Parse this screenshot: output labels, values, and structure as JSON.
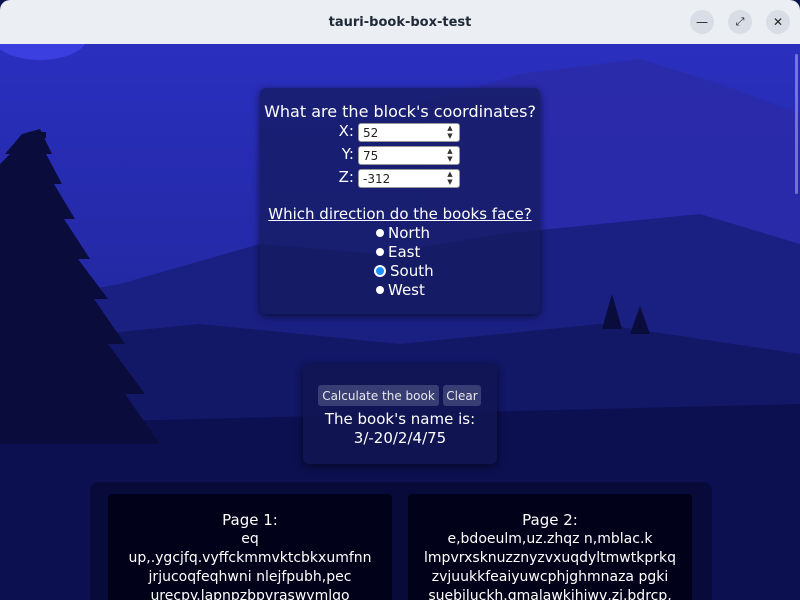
{
  "window": {
    "title": "tauri-book-box-test"
  },
  "coords": {
    "question": "What are the block's coordinates?",
    "x_label": "X:",
    "x_value": "52",
    "y_label": "Y:",
    "y_value": "75",
    "z_label": "Z:",
    "z_value": "-312"
  },
  "direction": {
    "question": "Which direction do the books face?",
    "options": [
      "North",
      "East",
      "South",
      "West"
    ],
    "selected": "South"
  },
  "actions": {
    "calculate_label": "Calculate the book",
    "clear_label": "Clear"
  },
  "result": {
    "label": "The book's name is:",
    "value": "3/-20/2/4/75"
  },
  "pages": [
    {
      "heading": "Page 1:",
      "lines": [
        "eq",
        "up,.ygcjfq.vyffckmmvktcbkxumfnn",
        "jrjucoqfeqhwni nlejfpubh,pec",
        "urecpy.lapnpzbpvraswymlqo"
      ]
    },
    {
      "heading": "Page 2:",
      "lines": [
        "e,bdoeulm,uz.zhqz n,mblac.k",
        "lmpvrxsknuzznyzvxuqdyltmwtkprkq",
        "zvjuukkfeaiyuwcphjghmnaza pgki",
        "suebjluckh.gmalawkjhjwv,zj.bdrcp,"
      ]
    }
  ],
  "colors": {
    "titlebar": "#ebeef3",
    "selected_radio": "#1e90ff",
    "sky": "#2a2fb8"
  }
}
